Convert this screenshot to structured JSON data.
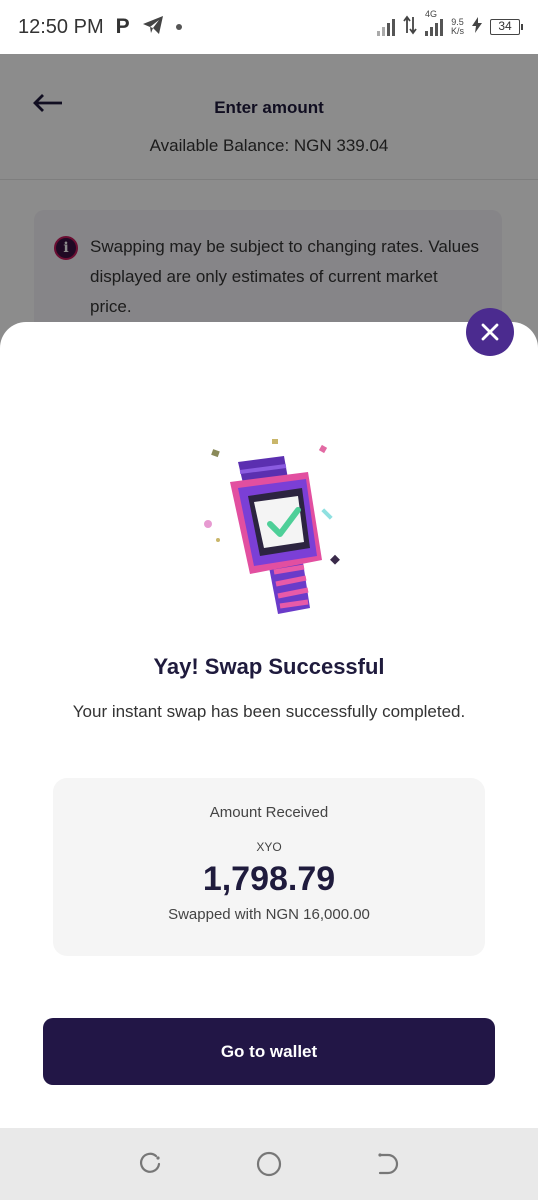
{
  "status_bar": {
    "time": "12:50 PM",
    "network_type": "4G",
    "speed_value": "9.5",
    "speed_unit": "K/s",
    "battery": "34"
  },
  "page": {
    "title": "Enter amount",
    "balance": "Available Balance: NGN 339.04",
    "notice": "Swapping may be subject to changing rates. Values displayed are only estimates of current market price."
  },
  "sheet": {
    "title": "Yay! Swap Successful",
    "subtitle": "Your instant swap has been successfully completed.",
    "amount_label": "Amount Received",
    "currency": "XYO",
    "amount": "1,798.79",
    "swapped_with": "Swapped with NGN 16,000.00",
    "button_label": "Go to wallet"
  },
  "colors": {
    "accent": "#4b2b8f",
    "button": "#221646",
    "title": "#1f1b3d"
  },
  "icons": {
    "back": "back-arrow-icon",
    "info": "info-icon",
    "close": "close-icon"
  }
}
